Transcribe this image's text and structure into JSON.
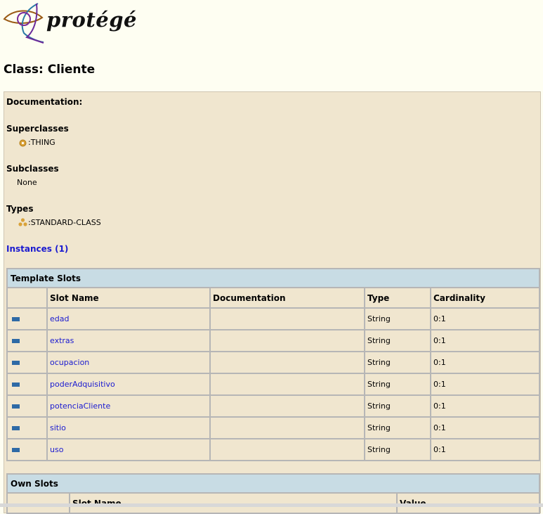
{
  "logo": {
    "text": "protégé"
  },
  "page_title": "Class: Cliente",
  "documentation": {
    "label": "Documentation:"
  },
  "superclasses": {
    "label": "Superclasses",
    "items": [
      ":THING"
    ]
  },
  "subclasses": {
    "label": "Subclasses",
    "value": "None"
  },
  "types": {
    "label": "Types",
    "items": [
      ":STANDARD-CLASS"
    ]
  },
  "instances_link": "Instances (1)",
  "template_slots": {
    "title": "Template Slots",
    "columns": [
      "Slot Name",
      "Documentation",
      "Type",
      "Cardinality"
    ],
    "rows": [
      {
        "name": "edad",
        "documentation": "",
        "type": "String",
        "cardinality": "0:1"
      },
      {
        "name": "extras",
        "documentation": "",
        "type": "String",
        "cardinality": "0:1"
      },
      {
        "name": "ocupacion",
        "documentation": "",
        "type": "String",
        "cardinality": "0:1"
      },
      {
        "name": "poderAdquisitivo",
        "documentation": "",
        "type": "String",
        "cardinality": "0:1"
      },
      {
        "name": "potenciaCliente",
        "documentation": "",
        "type": "String",
        "cardinality": "0:1"
      },
      {
        "name": "sitio",
        "documentation": "",
        "type": "String",
        "cardinality": "0:1"
      },
      {
        "name": "uso",
        "documentation": "",
        "type": "String",
        "cardinality": "0:1"
      }
    ]
  },
  "own_slots": {
    "title": "Own Slots",
    "columns": [
      "Slot Name",
      "Value"
    ]
  }
}
